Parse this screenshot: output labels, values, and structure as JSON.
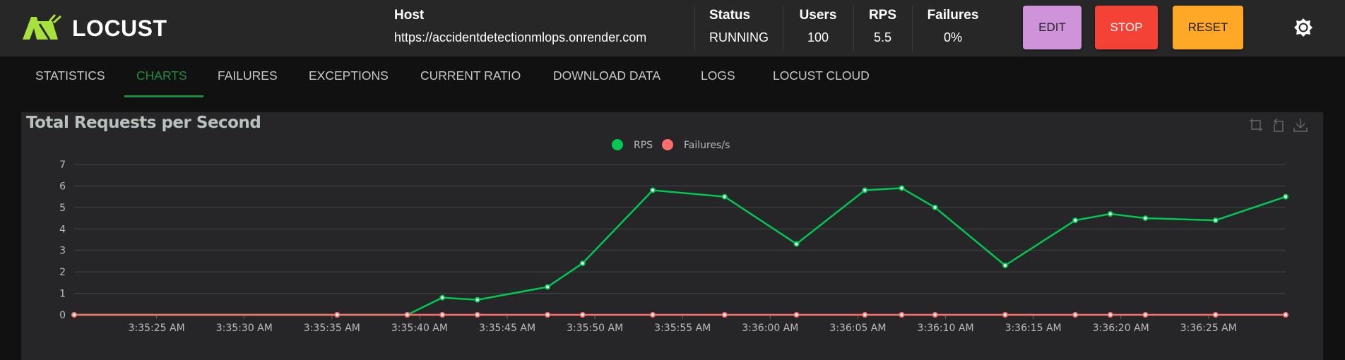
{
  "app": {
    "name": "LOCUST"
  },
  "header": {
    "host_label": "Host",
    "host_value": "https://accidentdetectionmlops.onrender.com",
    "status_label": "Status",
    "status_value": "RUNNING",
    "users_label": "Users",
    "users_value": "100",
    "rps_label": "RPS",
    "rps_value": "5.5",
    "failures_label": "Failures",
    "failures_value": "0%",
    "edit_label": "EDIT",
    "stop_label": "STOP",
    "reset_label": "RESET"
  },
  "colors": {
    "edit": "#ce93d8",
    "stop": "#f44336",
    "reset": "#ffa726",
    "accent": "#1e8e3e",
    "rps": "#00c853",
    "failures": "#ff6d6d"
  },
  "tabs": [
    {
      "label": "STATISTICS"
    },
    {
      "label": "CHARTS",
      "active": true
    },
    {
      "label": "FAILURES"
    },
    {
      "label": "EXCEPTIONS"
    },
    {
      "label": "CURRENT RATIO"
    },
    {
      "label": "DOWNLOAD DATA"
    },
    {
      "label": "LOGS"
    },
    {
      "label": "LOCUST CLOUD"
    }
  ],
  "chart_data": {
    "type": "line",
    "title": "Total Requests per Second",
    "legend": [
      "RPS",
      "Failures/s"
    ],
    "legend_placement": "top-center",
    "ylim": [
      0,
      7
    ],
    "yticks": [
      "0",
      "1",
      "2",
      "3",
      "4",
      "5",
      "6",
      "7"
    ],
    "xticks": [
      "3:35:25 AM",
      "3:35:30 AM",
      "3:35:35 AM",
      "3:35:40 AM",
      "3:35:45 AM",
      "3:35:50 AM",
      "3:35:55 AM",
      "3:36:00 AM",
      "3:36:05 AM",
      "3:36:10 AM",
      "3:36:15 AM",
      "3:36:20 AM",
      "3:36:25 AM"
    ],
    "x_seconds_after_3_35_20": [
      0.3,
      15.3,
      19.3,
      21.3,
      23.3,
      27.3,
      29.3,
      33.3,
      37.4,
      41.5,
      45.4,
      47.5,
      49.4,
      53.4,
      57.4,
      59.4,
      61.4,
      65.4,
      69.4
    ],
    "xlim_seconds": [
      0.3,
      69.4
    ],
    "series": [
      {
        "name": "RPS",
        "values": [
          0,
          0,
          0,
          0.8,
          0.7,
          1.3,
          2.4,
          5.8,
          5.5,
          3.3,
          5.8,
          5.9,
          5.0,
          2.3,
          4.4,
          4.7,
          4.5,
          4.4,
          5.5
        ]
      },
      {
        "name": "Failures/s",
        "values": [
          0,
          0,
          0,
          0,
          0,
          0,
          0,
          0,
          0,
          0,
          0,
          0,
          0,
          0,
          0,
          0,
          0,
          0,
          0
        ]
      }
    ],
    "grid": true
  }
}
